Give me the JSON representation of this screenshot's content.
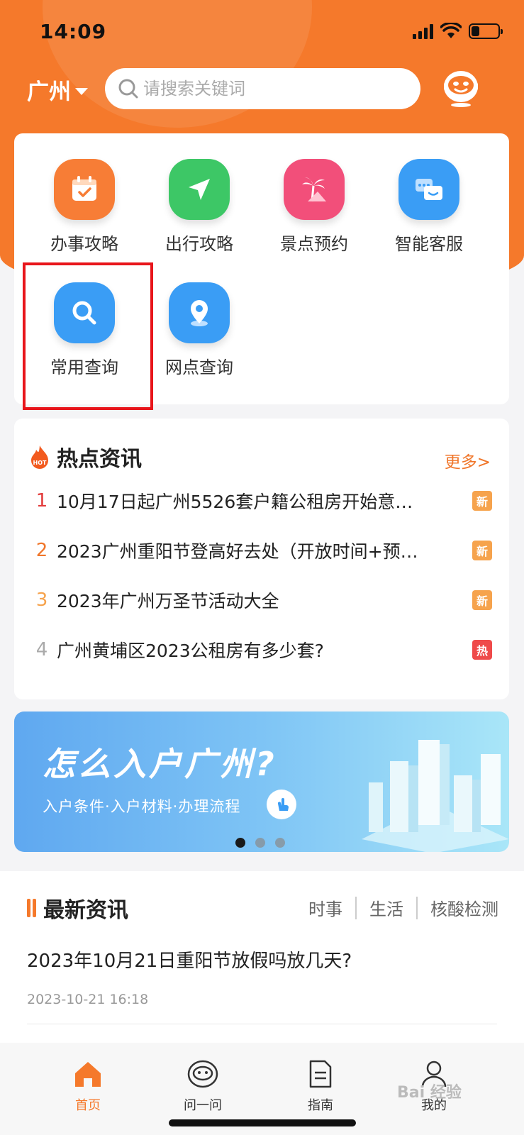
{
  "status": {
    "time": "14:09"
  },
  "header": {
    "city": "广州",
    "search_placeholder": "请搜索关键词"
  },
  "services": [
    {
      "label": "办事攻略",
      "icon": "calendar-icon",
      "color": "#f77d36"
    },
    {
      "label": "出行攻略",
      "icon": "navigation-icon",
      "color": "#3dc766"
    },
    {
      "label": "景点预约",
      "icon": "palm-tree-icon",
      "color": "#f24f7a"
    },
    {
      "label": "智能客服",
      "icon": "chat-icon",
      "color": "#3a9df5"
    },
    {
      "label": "常用查询",
      "icon": "search-icon",
      "color": "#3a9df5"
    },
    {
      "label": "网点查询",
      "icon": "location-pin-icon",
      "color": "#3a9df5"
    }
  ],
  "hot_news": {
    "title": "热点资讯",
    "more": "更多>",
    "items": [
      {
        "rank": "1",
        "text": "10月17日起广州5526套户籍公租房开始意…",
        "badge": "新",
        "rank_color": "#e23b3b",
        "badge_color": "#f6a34d"
      },
      {
        "rank": "2",
        "text": "2023广州重阳节登高好去处（开放时间+预…",
        "badge": "新",
        "rank_color": "#f0762a",
        "badge_color": "#f6a34d"
      },
      {
        "rank": "3",
        "text": "2023年广州万圣节活动大全",
        "badge": "新",
        "rank_color": "#f6a34d",
        "badge_color": "#f6a34d"
      },
      {
        "rank": "4",
        "text": "广州黄埔区2023公租房有多少套?",
        "badge": "热",
        "rank_color": "#aaaaaa",
        "badge_color": "#ef4a4a"
      }
    ]
  },
  "banner": {
    "title": "怎么入户广州?",
    "subtitle": "入户条件·入户材料·办理流程"
  },
  "latest": {
    "title": "最新资讯",
    "tabs": [
      "时事",
      "生活",
      "核酸检测"
    ],
    "article_title": "2023年10月21日重阳节放假吗放几天?",
    "article_time": "2023-10-21 16:18"
  },
  "tabbar": [
    {
      "label": "首页",
      "icon": "home-icon"
    },
    {
      "label": "问一问",
      "icon": "robot-icon"
    },
    {
      "label": "指南",
      "icon": "document-icon"
    },
    {
      "label": "我的",
      "icon": "user-icon"
    }
  ],
  "watermark": "Bai 经验",
  "colors": {
    "brand": "#f5792b",
    "highlight": "#e8151b"
  }
}
